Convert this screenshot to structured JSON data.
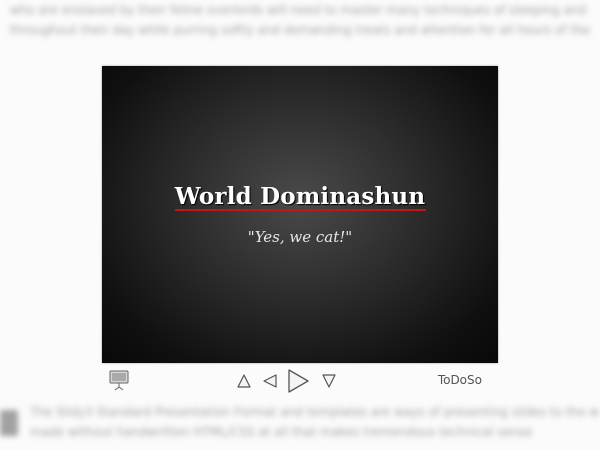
{
  "background": {
    "top_lines": [
      "who are enslaved by their feline overlords will need to master many techniques of sleeping and napping",
      "throughout their day while purring softly and demanding treats and attention for all hours of the day"
    ],
    "bottom_lines": [
      "The Slidy3 Standard Presentation Format and templates are ways of presenting slides to the world",
      "made without handwritten HTML/CSS at all that makes tremendous technical sense"
    ]
  },
  "slide": {
    "title": "World Dominashun",
    "subtitle": "\"Yes, we cat!\""
  },
  "toolbar": {
    "brand": "ToDoSo",
    "icons": [
      "presenter-icon",
      "up-icon",
      "previous-icon",
      "play-icon",
      "down-icon"
    ]
  },
  "colors": {
    "slide_bg": "#101010",
    "title_rule": "#c01818",
    "title_text": "#ffffff",
    "subtitle_text": "#e8e8e8"
  }
}
